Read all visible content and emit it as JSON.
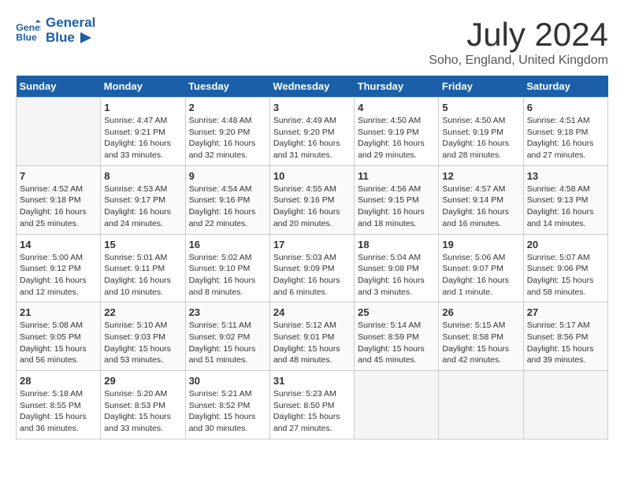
{
  "header": {
    "logo_line1": "General",
    "logo_line2": "Blue",
    "month_title": "July 2024",
    "location": "Soho, England, United Kingdom"
  },
  "days_of_week": [
    "Sunday",
    "Monday",
    "Tuesday",
    "Wednesday",
    "Thursday",
    "Friday",
    "Saturday"
  ],
  "weeks": [
    [
      {
        "num": "",
        "empty": true
      },
      {
        "num": "1",
        "sunrise": "4:47 AM",
        "sunset": "9:21 PM",
        "daylight": "16 hours and 33 minutes."
      },
      {
        "num": "2",
        "sunrise": "4:48 AM",
        "sunset": "9:20 PM",
        "daylight": "16 hours and 32 minutes."
      },
      {
        "num": "3",
        "sunrise": "4:49 AM",
        "sunset": "9:20 PM",
        "daylight": "16 hours and 31 minutes."
      },
      {
        "num": "4",
        "sunrise": "4:50 AM",
        "sunset": "9:19 PM",
        "daylight": "16 hours and 29 minutes."
      },
      {
        "num": "5",
        "sunrise": "4:50 AM",
        "sunset": "9:19 PM",
        "daylight": "16 hours and 28 minutes."
      },
      {
        "num": "6",
        "sunrise": "4:51 AM",
        "sunset": "9:18 PM",
        "daylight": "16 hours and 27 minutes."
      }
    ],
    [
      {
        "num": "7",
        "sunrise": "4:52 AM",
        "sunset": "9:18 PM",
        "daylight": "16 hours and 25 minutes."
      },
      {
        "num": "8",
        "sunrise": "4:53 AM",
        "sunset": "9:17 PM",
        "daylight": "16 hours and 24 minutes."
      },
      {
        "num": "9",
        "sunrise": "4:54 AM",
        "sunset": "9:16 PM",
        "daylight": "16 hours and 22 minutes."
      },
      {
        "num": "10",
        "sunrise": "4:55 AM",
        "sunset": "9:16 PM",
        "daylight": "16 hours and 20 minutes."
      },
      {
        "num": "11",
        "sunrise": "4:56 AM",
        "sunset": "9:15 PM",
        "daylight": "16 hours and 18 minutes."
      },
      {
        "num": "12",
        "sunrise": "4:57 AM",
        "sunset": "9:14 PM",
        "daylight": "16 hours and 16 minutes."
      },
      {
        "num": "13",
        "sunrise": "4:58 AM",
        "sunset": "9:13 PM",
        "daylight": "16 hours and 14 minutes."
      }
    ],
    [
      {
        "num": "14",
        "sunrise": "5:00 AM",
        "sunset": "9:12 PM",
        "daylight": "16 hours and 12 minutes."
      },
      {
        "num": "15",
        "sunrise": "5:01 AM",
        "sunset": "9:11 PM",
        "daylight": "16 hours and 10 minutes."
      },
      {
        "num": "16",
        "sunrise": "5:02 AM",
        "sunset": "9:10 PM",
        "daylight": "16 hours and 8 minutes."
      },
      {
        "num": "17",
        "sunrise": "5:03 AM",
        "sunset": "9:09 PM",
        "daylight": "16 hours and 6 minutes."
      },
      {
        "num": "18",
        "sunrise": "5:04 AM",
        "sunset": "9:08 PM",
        "daylight": "16 hours and 3 minutes."
      },
      {
        "num": "19",
        "sunrise": "5:06 AM",
        "sunset": "9:07 PM",
        "daylight": "16 hours and 1 minute."
      },
      {
        "num": "20",
        "sunrise": "5:07 AM",
        "sunset": "9:06 PM",
        "daylight": "15 hours and 58 minutes."
      }
    ],
    [
      {
        "num": "21",
        "sunrise": "5:08 AM",
        "sunset": "9:05 PM",
        "daylight": "15 hours and 56 minutes."
      },
      {
        "num": "22",
        "sunrise": "5:10 AM",
        "sunset": "9:03 PM",
        "daylight": "15 hours and 53 minutes."
      },
      {
        "num": "23",
        "sunrise": "5:11 AM",
        "sunset": "9:02 PM",
        "daylight": "15 hours and 51 minutes."
      },
      {
        "num": "24",
        "sunrise": "5:12 AM",
        "sunset": "9:01 PM",
        "daylight": "15 hours and 48 minutes."
      },
      {
        "num": "25",
        "sunrise": "5:14 AM",
        "sunset": "8:59 PM",
        "daylight": "15 hours and 45 minutes."
      },
      {
        "num": "26",
        "sunrise": "5:15 AM",
        "sunset": "8:58 PM",
        "daylight": "15 hours and 42 minutes."
      },
      {
        "num": "27",
        "sunrise": "5:17 AM",
        "sunset": "8:56 PM",
        "daylight": "15 hours and 39 minutes."
      }
    ],
    [
      {
        "num": "28",
        "sunrise": "5:18 AM",
        "sunset": "8:55 PM",
        "daylight": "15 hours and 36 minutes."
      },
      {
        "num": "29",
        "sunrise": "5:20 AM",
        "sunset": "8:53 PM",
        "daylight": "15 hours and 33 minutes."
      },
      {
        "num": "30",
        "sunrise": "5:21 AM",
        "sunset": "8:52 PM",
        "daylight": "15 hours and 30 minutes."
      },
      {
        "num": "31",
        "sunrise": "5:23 AM",
        "sunset": "8:50 PM",
        "daylight": "15 hours and 27 minutes."
      },
      {
        "num": "",
        "empty": true
      },
      {
        "num": "",
        "empty": true
      },
      {
        "num": "",
        "empty": true
      }
    ]
  ],
  "labels": {
    "sunrise_prefix": "Sunrise: ",
    "sunset_prefix": "Sunset: ",
    "daylight_prefix": "Daylight: "
  }
}
